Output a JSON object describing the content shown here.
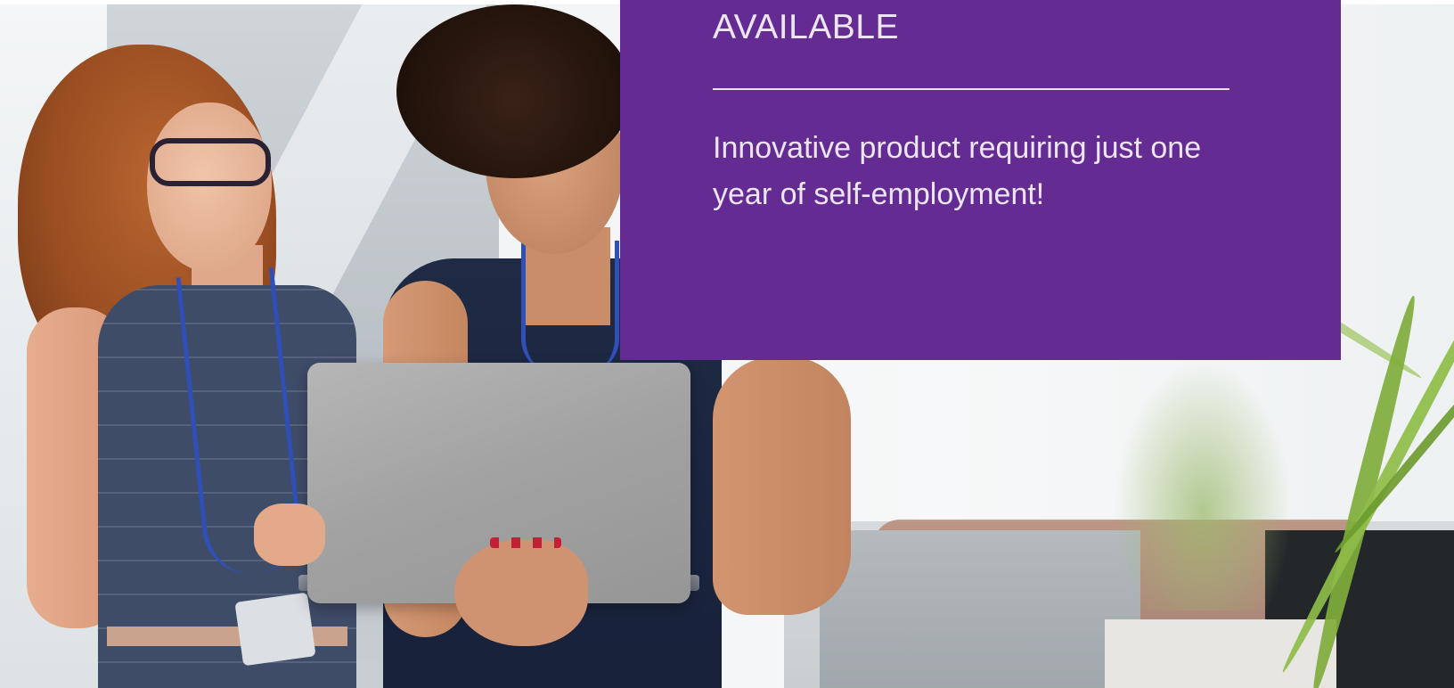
{
  "promo": {
    "heading": "AVAILABLE",
    "text": "Innovative product requiring just one year of self-employment!"
  },
  "theme": {
    "panel_color": "#642c92",
    "text_color": "#ece6f4",
    "divider_color": "#e9e2f2"
  }
}
